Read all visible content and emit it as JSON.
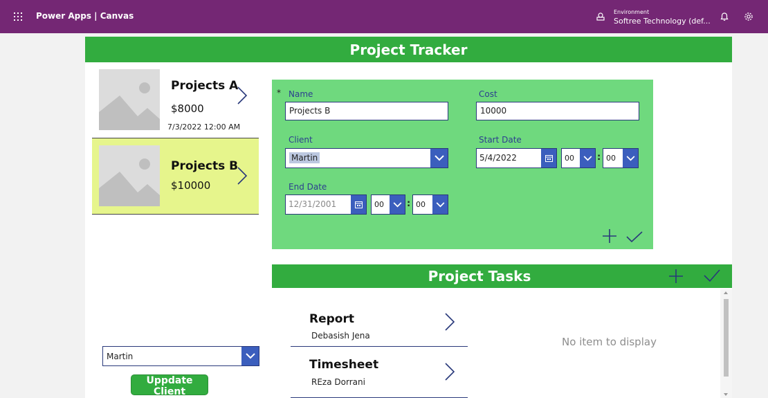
{
  "topbar": {
    "brand": "Power Apps | Canvas",
    "environment_label": "Environment",
    "environment_value": "Softree Technology (def...",
    "icons": [
      "app-launcher-icon",
      "environment-icon",
      "notification-bell-icon",
      "settings-gear-icon"
    ]
  },
  "app": {
    "title": "Project Tracker",
    "colors": {
      "header": "#32ac3f",
      "form": "#6fd97e",
      "selected": "#e6f58c",
      "topbar": "#742774",
      "accent": "#3b5ebd"
    }
  },
  "projects": [
    {
      "name": "Projects A",
      "cost": "$8000",
      "date": "7/3/2022 12:00 AM",
      "selected": false
    },
    {
      "name": "Projects B",
      "cost": "$10000",
      "date": "",
      "selected": true
    }
  ],
  "form": {
    "required_mark": "*",
    "name_label": "Name",
    "name_value": "Projects B",
    "cost_label": "Cost",
    "cost_value": "10000",
    "client_label": "Client",
    "client_value": "Martin",
    "start_label": "Start Date",
    "start_date": "5/4/2022",
    "start_hour": "00",
    "start_minute": "00",
    "end_label": "End Date",
    "end_date": "12/31/2001",
    "end_hour": "00",
    "end_minute": "00",
    "colon": ":"
  },
  "tasks": {
    "title": "Project Tasks",
    "items": [
      {
        "name": "Report",
        "owner": "Debasish Jena"
      },
      {
        "name": "Timesheet",
        "owner": "REza Dorrani"
      }
    ],
    "empty_text": "No item to display"
  },
  "client_select": {
    "value": "Martin"
  },
  "update_button": {
    "label": "Uppdate Client"
  }
}
